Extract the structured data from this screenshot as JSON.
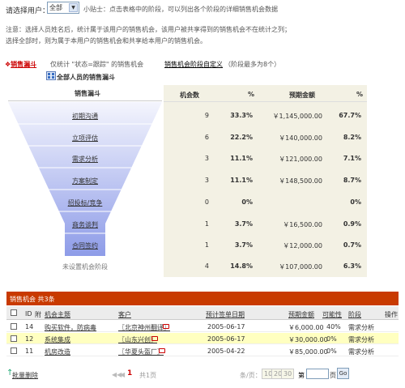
{
  "filter": {
    "label": "请选择用户：",
    "selected": "全部",
    "tip": "小贴士：点击表格中的阶段，可以列出各个阶段的详细销售机会数据"
  },
  "notes": [
    "注意：选择人员姓名后，统计属于该用户的销售机会，该用户被共享得到的销售机会不在统计之列；",
    "选择全部时，则为属于本用户的销售机会和共享给本用户的销售机会。"
  ],
  "tabs": {
    "funnel": "销售漏斗",
    "desc": "仅统计 \"状态=跟踪\" 的销售机会",
    "custom": "销售机会阶段自定义",
    "hint": "（阶段最多为8个）"
  },
  "scope": "全部人员的销售漏斗",
  "funnel": {
    "header": "销售漏斗",
    "col_count": "机会数",
    "col_pct": "%",
    "col_amount": "预期金额",
    "col_amount_pct": "%",
    "stages": [
      {
        "name": "初期沟通",
        "count": "9",
        "pct": "33.3%",
        "amount": "￥1,145,000.00",
        "amount_pct": "67.7%"
      },
      {
        "name": "立项评估",
        "count": "6",
        "pct": "22.2%",
        "amount": "￥140,000.00",
        "amount_pct": "8.2%"
      },
      {
        "name": "需求分析",
        "count": "3",
        "pct": "11.1%",
        "amount": "￥121,000.00",
        "amount_pct": "7.1%"
      },
      {
        "name": "方案制定",
        "count": "3",
        "pct": "11.1%",
        "amount": "￥148,500.00",
        "amount_pct": "8.7%"
      },
      {
        "name": "招投标/竞争",
        "count": "0",
        "pct": "0%",
        "amount": "",
        "amount_pct": "0%"
      },
      {
        "name": "商务谈判",
        "count": "1",
        "pct": "3.7%",
        "amount": "￥16,500.00",
        "amount_pct": "0.9%"
      },
      {
        "name": "合同签约",
        "count": "1",
        "pct": "3.7%",
        "amount": "￥12,000.00",
        "amount_pct": "0.7%"
      },
      {
        "name": "未设置机会阶段",
        "count": "4",
        "pct": "14.8%",
        "amount": "￥107,000.00",
        "amount_pct": "6.3%"
      }
    ]
  },
  "opportunities": {
    "title": "销售机会 共3条",
    "headers": {
      "id": "ID",
      "attach": "附",
      "subject": "机会主题",
      "customer": "客户",
      "date": "预计签单日期",
      "amount": "预期金额",
      "possibility": "可能性",
      "stage": "阶段",
      "ops": "操作"
    },
    "rows": [
      {
        "id": "14",
        "subject": "购买软件，防病毒",
        "customer": "〖北京神州翻译〗",
        "date": "2005-06-17",
        "amount": "￥6,000.00",
        "possibility": "40%",
        "stage": "需求分析"
      },
      {
        "id": "12",
        "subject": "系统集成",
        "customer": "〖山东兴创〗",
        "date": "2005-06-17",
        "amount": "￥30,000.00",
        "possibility": "0%",
        "stage": "需求分析"
      },
      {
        "id": "11",
        "subject": "机房改造",
        "customer": "〖华夏头盔厂〗",
        "date": "2005-04-22",
        "amount": "￥85,000.00",
        "possibility": "0%",
        "stage": "需求分析"
      }
    ]
  },
  "pagination": {
    "bulk_delete": "批量删除",
    "current": "1",
    "total": "共1页",
    "per_page_label": "条/页：",
    "sizes": [
      "10",
      "20",
      "30"
    ],
    "jump_prefix": "第",
    "jump_suffix": "页",
    "go": "Go"
  },
  "colors": {
    "accent_red": "#c83a00",
    "funnel_top": "#eef0fb",
    "funnel_bottom": "#9aa6ea",
    "panel": "#f3f1e4",
    "highlight_row": "#ffffc0"
  }
}
